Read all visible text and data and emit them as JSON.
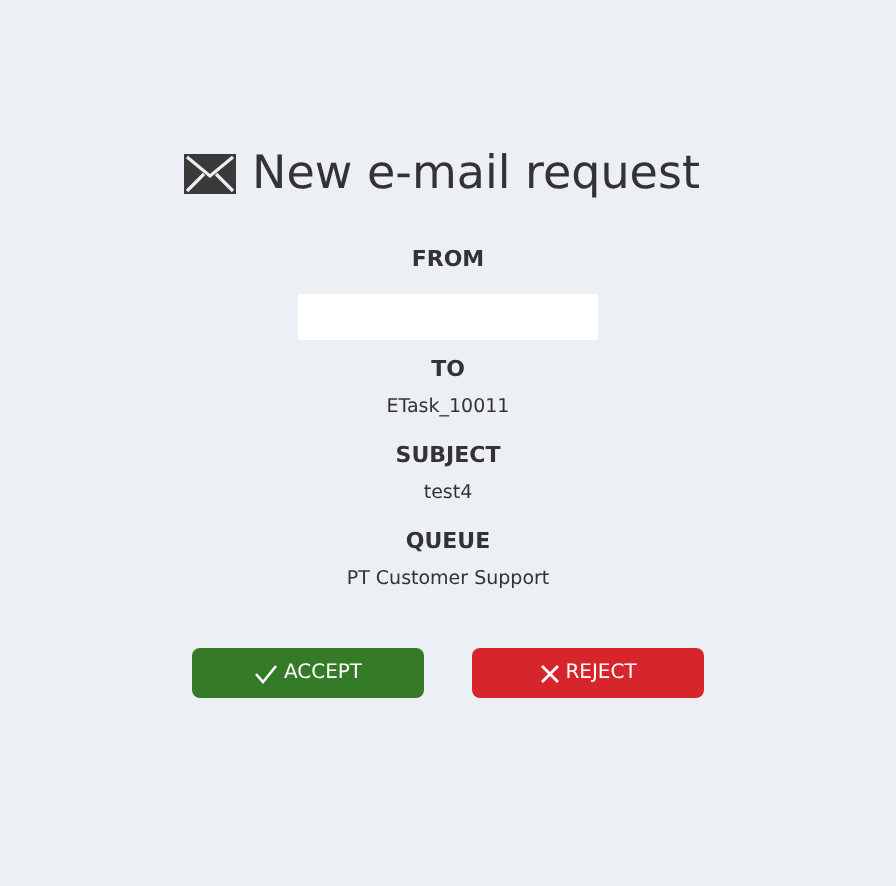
{
  "title": "New e-mail request",
  "fields": [
    {
      "label": "FROM",
      "kind": "box"
    },
    {
      "label": "TO",
      "kind": "text",
      "value": "ETask_10011"
    },
    {
      "label": "SUBJECT",
      "kind": "text",
      "value": "test4"
    },
    {
      "label": "QUEUE",
      "kind": "text",
      "value": "PT Customer Support"
    }
  ],
  "buttons": [
    {
      "label": "ACCEPT",
      "kind": "accept"
    },
    {
      "label": "REJECT",
      "kind": "reject"
    }
  ]
}
